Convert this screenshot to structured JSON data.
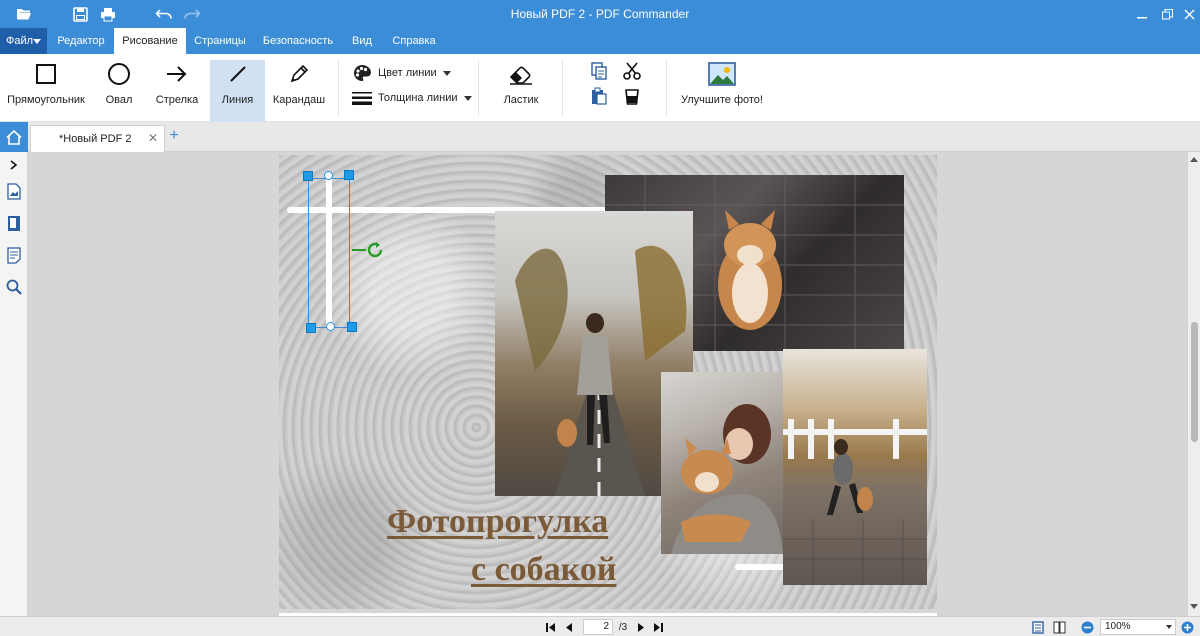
{
  "window": {
    "title": "Новый PDF 2 - PDF Commander"
  },
  "menu": {
    "file_label": "Файл",
    "tabs": [
      "Редактор",
      "Рисование",
      "Страницы",
      "Безопасность",
      "Вид",
      "Справка"
    ],
    "active_tab": "Рисование"
  },
  "ribbon": {
    "rectangle": "Прямоугольник",
    "oval": "Овал",
    "arrow": "Стрелка",
    "line": "Линия",
    "pencil": "Карандаш",
    "line_color": "Цвет линии",
    "line_thickness": "Толщина линии",
    "eraser": "Ластик",
    "enhance_photo": "Улучшите фото!"
  },
  "document_tab": {
    "name": "*Новый PDF 2"
  },
  "page_content": {
    "title_line1": "Фотопрогулка",
    "title_line2": "с собакой"
  },
  "status": {
    "current_page": "2",
    "total_pages": "/3",
    "zoom": "100%"
  },
  "colors": {
    "accent": "#3a8dd6",
    "title_brown": "#7a5a38",
    "selection_handle": "#1f9be8"
  }
}
